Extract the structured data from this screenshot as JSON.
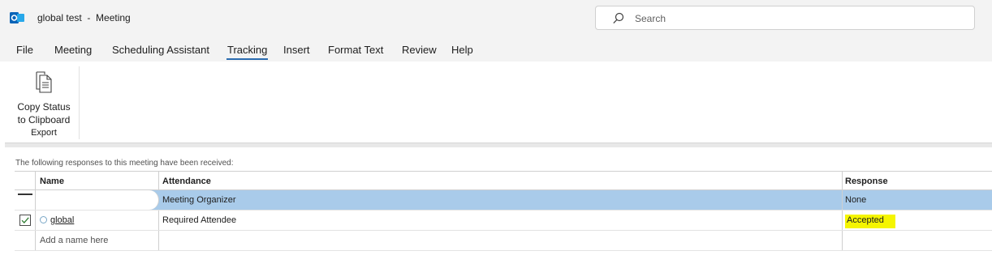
{
  "window": {
    "title": "global test  -  Meeting",
    "app_icon": "outlook-icon",
    "search_placeholder": "Search"
  },
  "ribbon": {
    "tabs": [
      {
        "label": "File"
      },
      {
        "label": "Meeting"
      },
      {
        "label": "Scheduling Assistant"
      },
      {
        "label": "Tracking",
        "active": true
      },
      {
        "label": "Insert"
      },
      {
        "label": "Format Text"
      },
      {
        "label": "Review"
      },
      {
        "label": "Help"
      }
    ],
    "copy_status_line1": "Copy Status",
    "copy_status_line2": "to Clipboard",
    "group_label": "Export"
  },
  "tracking": {
    "info_text": "The following responses to this meeting have been received:",
    "headers": {
      "name": "Name",
      "attendance": "Attendance",
      "response": "Response"
    },
    "rows": [
      {
        "name": "",
        "attendance": "Meeting Organizer",
        "response": "None",
        "selected": true
      },
      {
        "name": "global",
        "attendance": "Required Attendee",
        "response": "Accepted",
        "checked": true,
        "response_highlight": "#f5f500"
      }
    ],
    "add_placeholder": "Add a name here"
  },
  "colors": {
    "selection": "#a9cbea",
    "accent": "#2b6cb0",
    "highlight": "#f5f500"
  }
}
